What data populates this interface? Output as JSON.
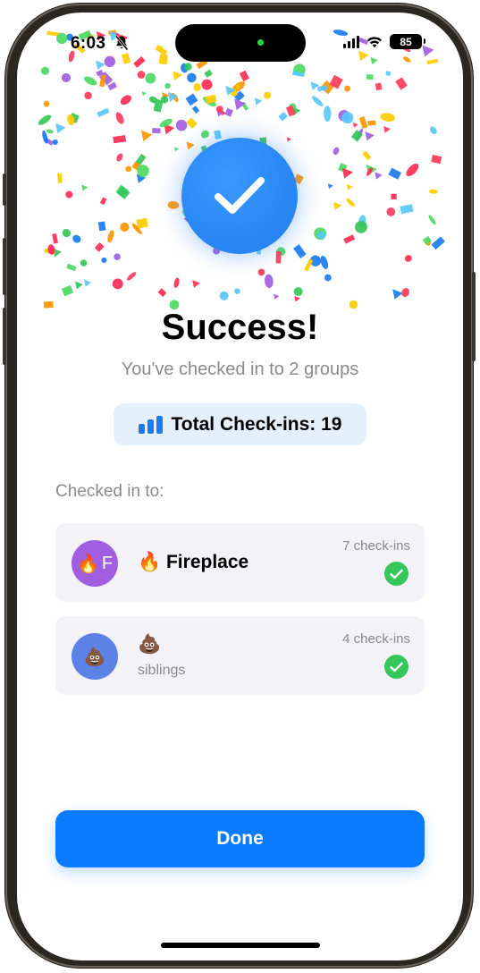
{
  "status_bar": {
    "time": "6:03",
    "battery": "85"
  },
  "success": {
    "title": "Success!",
    "subtitle": "You've checked in to 2 groups"
  },
  "total": {
    "label": "Total Check-ins: 19"
  },
  "section_label": "Checked in to:",
  "groups": [
    {
      "avatar_emoji": "🔥",
      "avatar_letter": "F",
      "name": "🔥 Fireplace",
      "count": "7 check-ins"
    },
    {
      "avatar_emoji": "💩",
      "name": "💩",
      "sub": "siblings",
      "count": "4 check-ins"
    }
  ],
  "done_label": "Done",
  "colors": {
    "accent": "#0a7bff",
    "success_green": "#34c759",
    "pill_bg": "#e4f0fc",
    "card_bg": "#f2f2f7",
    "avatar_purple": "#a25ee0",
    "avatar_blue": "#5b82e6"
  },
  "icons": [
    "bell-slash-icon",
    "cellular-signal-icon",
    "wifi-icon",
    "battery-icon",
    "checkmark-icon",
    "bar-chart-icon"
  ]
}
